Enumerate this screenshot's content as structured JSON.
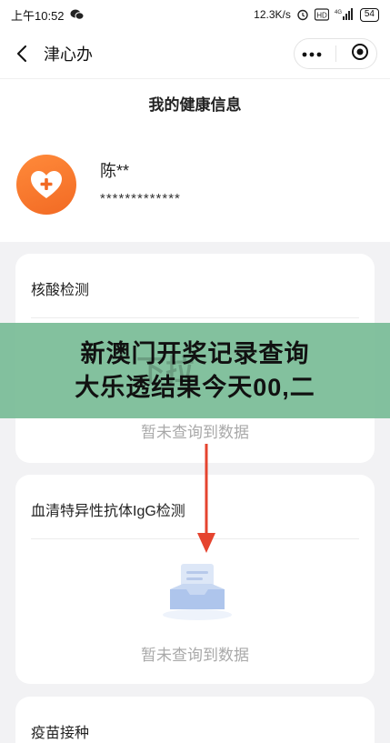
{
  "status_bar": {
    "time": "上午10:52",
    "network_speed": "12.3K/s",
    "signal_label": "HD",
    "network_type": "4G",
    "battery": "54"
  },
  "nav": {
    "title": "津心办"
  },
  "page": {
    "title": "我的健康信息"
  },
  "profile": {
    "name": "陈**",
    "id_masked": "*************"
  },
  "sections": [
    {
      "title": "核酸检测",
      "empty_text": ""
    },
    {
      "title": "血清特异性抗体IgG检测",
      "empty_text": "暂未查询到数据"
    },
    {
      "title": "疫苗接种"
    }
  ],
  "overlay": {
    "empty_text": "暂未查询到数据",
    "watermark": "下拉",
    "banner_line1": "新澳门开奖记录查询",
    "banner_line2": "大乐透结果今天00,二"
  },
  "colors": {
    "accent_orange": "#f26a24",
    "banner_green": "#78bc96",
    "arrow_red": "#e5442f"
  }
}
